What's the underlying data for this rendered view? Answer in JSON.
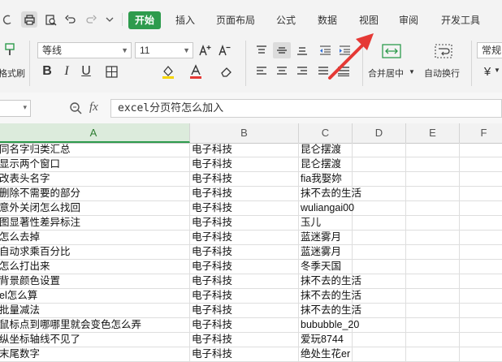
{
  "tabs": [
    {
      "label": "开始",
      "active": true
    },
    {
      "label": "插入"
    },
    {
      "label": "页面布局"
    },
    {
      "label": "公式"
    },
    {
      "label": "数据"
    },
    {
      "label": "视图"
    },
    {
      "label": "审阅"
    },
    {
      "label": "开发工具"
    }
  ],
  "ribbon": {
    "format_painter_label": "格式刷",
    "font_name": "等线",
    "font_size": "11",
    "merge_label": "合并居中",
    "wrap_label": "自动换行",
    "number_format": "常规",
    "currency_symbol": "¥"
  },
  "formula_bar": {
    "fx_label": "fx",
    "content": "excel分页符怎么加入"
  },
  "columns": [
    "A",
    "B",
    "C",
    "D",
    "E",
    "F"
  ],
  "rows": [
    {
      "a": "同名字归类汇总",
      "b": "电子科技",
      "c": "昆仑摆渡"
    },
    {
      "a": "显示两个窗口",
      "b": "电子科技",
      "c": "昆仑摆渡"
    },
    {
      "a": "改表头名字",
      "b": "电子科技",
      "c": "fia我娶妳"
    },
    {
      "a": "删除不需要的部分",
      "b": "电子科技",
      "c": "抹不去的生活"
    },
    {
      "a": "意外关闭怎么找回",
      "b": "电子科技",
      "c": "wuliangai00"
    },
    {
      "a": "图显著性差异标注",
      "b": "电子科技",
      "c": "玉儿"
    },
    {
      "a": "怎么去掉",
      "b": "电子科技",
      "c": "蓝迷雾月"
    },
    {
      "a": "自动求乘百分比",
      "b": "电子科技",
      "c": "蓝迷雾月"
    },
    {
      "a": "怎么打出来",
      "b": "电子科技",
      "c": "冬季天国"
    },
    {
      "a": "背景颜色设置",
      "b": "电子科技",
      "c": "抹不去的生活"
    },
    {
      "a": "el怎么算",
      "b": "电子科技",
      "c": "抹不去的生活"
    },
    {
      "a": "批量减法",
      "b": "电子科技",
      "c": "抹不去的生活"
    },
    {
      "a": "鼠标点到哪哪里就会变色怎么弄",
      "b": "电子科技",
      "c": "bububble_20"
    },
    {
      "a": "纵坐标轴线不见了",
      "b": "电子科技",
      "c": "爱玩8744"
    },
    {
      "a": "末尾数字",
      "b": "电子科技",
      "c": "绝处生花er"
    }
  ],
  "colors": {
    "accent": "#2e9b4d",
    "arrow": "#e53935"
  }
}
